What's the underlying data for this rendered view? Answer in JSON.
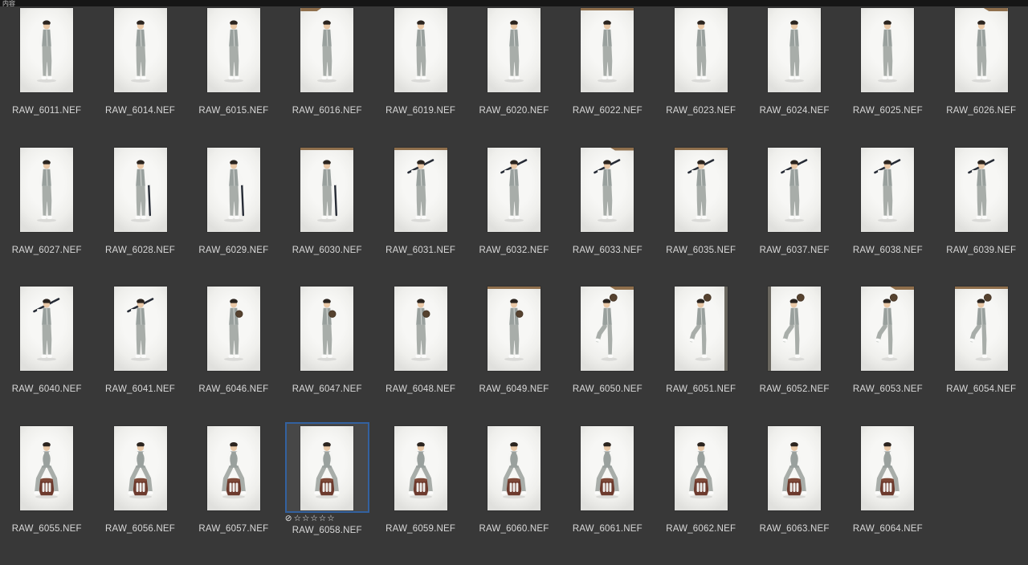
{
  "topbar": {
    "label": "内容"
  },
  "rating": {
    "reject": "⊘",
    "stars": "☆☆☆☆☆"
  },
  "colors": {
    "background": "#383838",
    "topbar": "#161616",
    "filename_text": "#d9d9d9",
    "selection_border": "#33619f",
    "selection_background": "#474747"
  },
  "grid": {
    "columns": 11,
    "items": [
      {
        "name": "RAW_6011.NEF",
        "pose": "stand",
        "backdrop": "plain",
        "selected": false
      },
      {
        "name": "RAW_6014.NEF",
        "pose": "stand",
        "backdrop": "plain",
        "selected": false
      },
      {
        "name": "RAW_6015.NEF",
        "pose": "stand",
        "backdrop": "plain",
        "selected": false
      },
      {
        "name": "RAW_6016.NEF",
        "pose": "stand",
        "backdrop": "top-left",
        "selected": false
      },
      {
        "name": "RAW_6019.NEF",
        "pose": "stand",
        "backdrop": "plain",
        "selected": false
      },
      {
        "name": "RAW_6020.NEF",
        "pose": "stand",
        "backdrop": "plain",
        "selected": false
      },
      {
        "name": "RAW_6022.NEF",
        "pose": "stand",
        "backdrop": "top",
        "selected": false
      },
      {
        "name": "RAW_6023.NEF",
        "pose": "stand",
        "backdrop": "plain",
        "selected": false
      },
      {
        "name": "RAW_6024.NEF",
        "pose": "stand",
        "backdrop": "plain",
        "selected": false
      },
      {
        "name": "RAW_6025.NEF",
        "pose": "stand",
        "backdrop": "plain",
        "selected": false
      },
      {
        "name": "RAW_6026.NEF",
        "pose": "stand",
        "backdrop": "top-right",
        "selected": false
      },
      {
        "name": "RAW_6027.NEF",
        "pose": "stand",
        "backdrop": "plain",
        "selected": false
      },
      {
        "name": "RAW_6028.NEF",
        "pose": "bat-down",
        "backdrop": "plain",
        "selected": false
      },
      {
        "name": "RAW_6029.NEF",
        "pose": "bat-down",
        "backdrop": "plain",
        "selected": false
      },
      {
        "name": "RAW_6030.NEF",
        "pose": "bat-down",
        "backdrop": "top",
        "selected": false
      },
      {
        "name": "RAW_6031.NEF",
        "pose": "bat-shoulder",
        "backdrop": "top",
        "selected": false
      },
      {
        "name": "RAW_6032.NEF",
        "pose": "bat-shoulder",
        "backdrop": "plain",
        "selected": false
      },
      {
        "name": "RAW_6033.NEF",
        "pose": "bat-shoulder",
        "backdrop": "top-right",
        "selected": false
      },
      {
        "name": "RAW_6035.NEF",
        "pose": "bat-shoulder",
        "backdrop": "top",
        "selected": false
      },
      {
        "name": "RAW_6037.NEF",
        "pose": "bat-shoulder",
        "backdrop": "plain",
        "selected": false
      },
      {
        "name": "RAW_6038.NEF",
        "pose": "bat-shoulder",
        "backdrop": "plain",
        "selected": false
      },
      {
        "name": "RAW_6039.NEF",
        "pose": "bat-shoulder",
        "backdrop": "plain",
        "selected": false
      },
      {
        "name": "RAW_6040.NEF",
        "pose": "bat-shoulder",
        "backdrop": "plain",
        "selected": false
      },
      {
        "name": "RAW_6041.NEF",
        "pose": "bat-shoulder",
        "backdrop": "plain",
        "selected": false
      },
      {
        "name": "RAW_6046.NEF",
        "pose": "glove",
        "backdrop": "plain",
        "selected": false
      },
      {
        "name": "RAW_6047.NEF",
        "pose": "glove",
        "backdrop": "plain",
        "selected": false
      },
      {
        "name": "RAW_6048.NEF",
        "pose": "glove",
        "backdrop": "plain",
        "selected": false
      },
      {
        "name": "RAW_6049.NEF",
        "pose": "glove",
        "backdrop": "top",
        "selected": false
      },
      {
        "name": "RAW_6050.NEF",
        "pose": "pitch",
        "backdrop": "top-right",
        "selected": false
      },
      {
        "name": "RAW_6051.NEF",
        "pose": "pitch",
        "backdrop": "right-edge",
        "selected": false
      },
      {
        "name": "RAW_6052.NEF",
        "pose": "pitch",
        "backdrop": "left-edge",
        "selected": false
      },
      {
        "name": "RAW_6053.NEF",
        "pose": "pitch",
        "backdrop": "top-right",
        "selected": false
      },
      {
        "name": "RAW_6054.NEF",
        "pose": "pitch",
        "backdrop": "top",
        "selected": false
      },
      {
        "name": "RAW_6055.NEF",
        "pose": "stool",
        "backdrop": "plain",
        "selected": false
      },
      {
        "name": "RAW_6056.NEF",
        "pose": "stool",
        "backdrop": "plain",
        "selected": false
      },
      {
        "name": "RAW_6057.NEF",
        "pose": "stool",
        "backdrop": "plain",
        "selected": false
      },
      {
        "name": "RAW_6058.NEF",
        "pose": "stool",
        "backdrop": "plain",
        "selected": true
      },
      {
        "name": "RAW_6059.NEF",
        "pose": "stool",
        "backdrop": "plain",
        "selected": false
      },
      {
        "name": "RAW_6060.NEF",
        "pose": "stool",
        "backdrop": "plain",
        "selected": false
      },
      {
        "name": "RAW_6061.NEF",
        "pose": "stool",
        "backdrop": "plain",
        "selected": false
      },
      {
        "name": "RAW_6062.NEF",
        "pose": "stool",
        "backdrop": "plain",
        "selected": false
      },
      {
        "name": "RAW_6063.NEF",
        "pose": "stool",
        "backdrop": "plain",
        "selected": false
      },
      {
        "name": "RAW_6064.NEF",
        "pose": "stool",
        "backdrop": "plain",
        "selected": false
      }
    ]
  }
}
